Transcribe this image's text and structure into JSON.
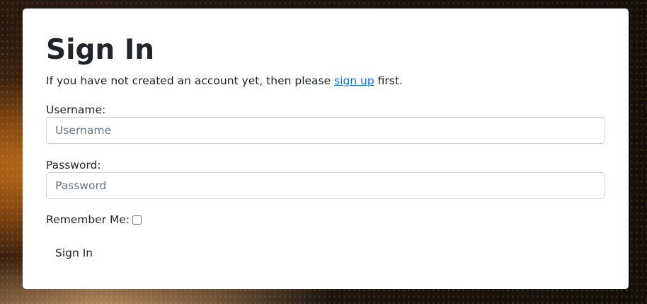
{
  "signin": {
    "title": "Sign In",
    "intro_before": "If you have not created an account yet, then please ",
    "intro_link": "sign up",
    "intro_after": " first.",
    "username_label": "Username:",
    "username_placeholder": "Username",
    "password_label": "Password:",
    "password_placeholder": "Password",
    "remember_label": "Remember Me:",
    "remember_checked": false,
    "submit_label": "Sign In"
  }
}
